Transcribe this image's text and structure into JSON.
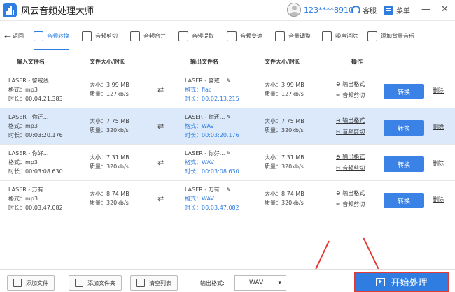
{
  "app": {
    "title": "风云音频处理大师"
  },
  "user": {
    "id": "123****8910",
    "service": "客服",
    "menu": "菜单"
  },
  "window": {
    "minimize": "—",
    "close": "✕"
  },
  "nav": {
    "back": "返回",
    "tabs": [
      {
        "label": "音频转换",
        "icon": "convert-icon",
        "active": true
      },
      {
        "label": "音频剪切",
        "icon": "cut-icon"
      },
      {
        "label": "音频合并",
        "icon": "merge-icon"
      },
      {
        "label": "音频提取",
        "icon": "extract-icon"
      },
      {
        "label": "音频变速",
        "icon": "speed-icon"
      },
      {
        "label": "音量调整",
        "icon": "volume-icon"
      },
      {
        "label": "噪声消除",
        "icon": "noise-icon"
      },
      {
        "label": "添加背景音乐",
        "icon": "music-icon"
      }
    ]
  },
  "table": {
    "headers": {
      "input_name": "输入文件名",
      "in_size": "文件大小/时长",
      "output_name": "输出文件名",
      "out_size": "文件大小/时长",
      "ops": "操作"
    },
    "rows": [
      {
        "in_name": "LASER - 警戒线",
        "in_fmt": "格式：mp3",
        "in_dur": "时长：00:04:21.383",
        "in_size": "大小：3.99 MB",
        "in_quality": "质量：127kb/s",
        "out_name": "LASER - 警戒...",
        "out_fmt": "格式：flac",
        "out_dur": "时长：00:02:13.215",
        "out_size": "大小：3.99 MB",
        "out_quality": "质量：127kb/s"
      },
      {
        "in_name": "LASER - 你还...",
        "in_fmt": "格式：mp3",
        "in_dur": "时长：00:03:20.176",
        "in_size": "大小：7.75 MB",
        "in_quality": "质量：320kb/s",
        "out_name": "LASER - 你还...",
        "out_fmt": "格式：WAV",
        "out_dur": "时长：00:03:20.176",
        "out_size": "大小：7.75 MB",
        "out_quality": "质量：320kb/s"
      },
      {
        "in_name": "LASER - 你好...",
        "in_fmt": "格式：mp3",
        "in_dur": "时长：00:03:08.630",
        "in_size": "大小：7.31 MB",
        "in_quality": "质量：320kb/s",
        "out_name": "LASER - 你好...",
        "out_fmt": "格式：WAV",
        "out_dur": "时长：00:03:08.630",
        "out_size": "大小：7.31 MB",
        "out_quality": "质量：320kb/s"
      },
      {
        "in_name": "LASER - 万有...",
        "in_fmt": "格式：mp3",
        "in_dur": "时长：00:03:47.082",
        "in_size": "大小：8.74 MB",
        "in_quality": "质量：320kb/s",
        "out_name": "LASER - 万有...",
        "out_fmt": "格式：WAV",
        "out_dur": "时长：00:03:47.082",
        "out_size": "大小：8.74 MB",
        "out_quality": "质量：320kb/s"
      }
    ],
    "actions": {
      "format": "输出格式",
      "cut": "音频剪切",
      "convert": "转换",
      "delete": "删除"
    }
  },
  "bottom": {
    "add_file": "添加文件",
    "add_folder": "添加文件夹",
    "clear": "清空列表",
    "format_label": "输出格式:",
    "format_value": "WAV",
    "start": "开始处理"
  },
  "colors": {
    "accent": "#2f7de1",
    "selected_row": "#dbe9fb",
    "highlight_border": "#e53935"
  }
}
